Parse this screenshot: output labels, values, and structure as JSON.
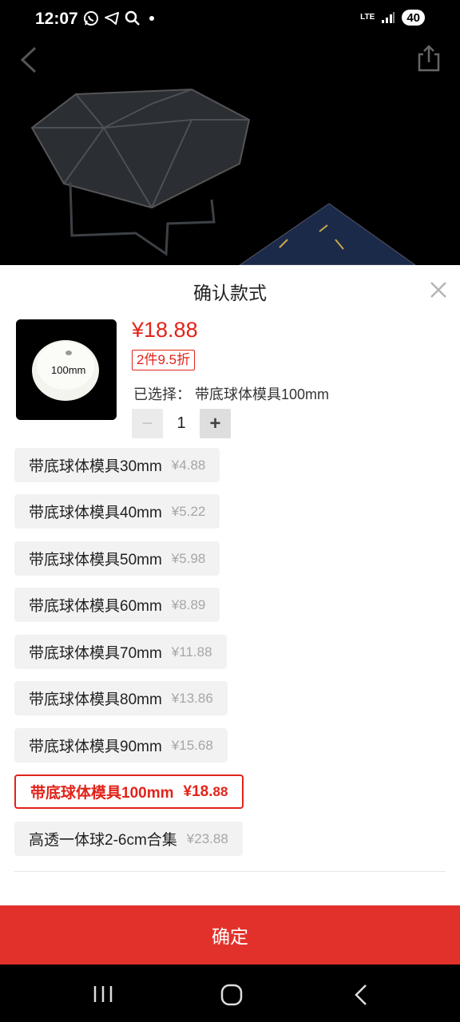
{
  "status_bar": {
    "time": "12:07",
    "network": "LTE",
    "battery": "40",
    "icons": [
      "whatsapp-icon",
      "telegram-icon",
      "search-icon",
      "dot-icon",
      "signal-icon"
    ]
  },
  "header": {
    "back_icon": "back-chevron-icon",
    "share_icon": "share-icon"
  },
  "sheet": {
    "title": "确认款式",
    "close_icon": "close-icon",
    "thumbnail_label": "100mm",
    "price": "¥18.88",
    "discount_badge": "2件9.5折",
    "selected_text": "已选择：  带底球体模具100mm",
    "quantity": "1",
    "minus": "−",
    "plus": "+",
    "options": [
      {
        "name": "带底球体模具30mm",
        "price_main": "¥4.",
        "price_tail": "88",
        "selected": false
      },
      {
        "name": "带底球体模具40mm",
        "price_main": "¥5.",
        "price_tail": "22",
        "selected": false
      },
      {
        "name": "带底球体模具50mm",
        "price_main": "¥5.",
        "price_tail": "98",
        "selected": false
      },
      {
        "name": "带底球体模具60mm",
        "price_main": "¥8.",
        "price_tail": "89",
        "selected": false
      },
      {
        "name": "带底球体模具70mm",
        "price_main": "¥11.",
        "price_tail": "88",
        "selected": false
      },
      {
        "name": "带底球体模具80mm",
        "price_main": "¥13.",
        "price_tail": "86",
        "selected": false
      },
      {
        "name": "带底球体模具90mm",
        "price_main": "¥15.",
        "price_tail": "68",
        "selected": false
      },
      {
        "name": "带底球体模具100mm",
        "price_main": "¥18.",
        "price_tail": "88",
        "selected": true
      },
      {
        "name": "高透一体球2-6cm合集",
        "price_main": "¥23.",
        "price_tail": "88",
        "selected": false
      }
    ],
    "confirm_label": "确定"
  },
  "nav_bar": {
    "recents_icon": "recents-icon",
    "home_icon": "home-icon",
    "back_icon": "back-icon"
  },
  "colors": {
    "accent": "#e2231a",
    "confirm_bg": "#e2312a"
  }
}
